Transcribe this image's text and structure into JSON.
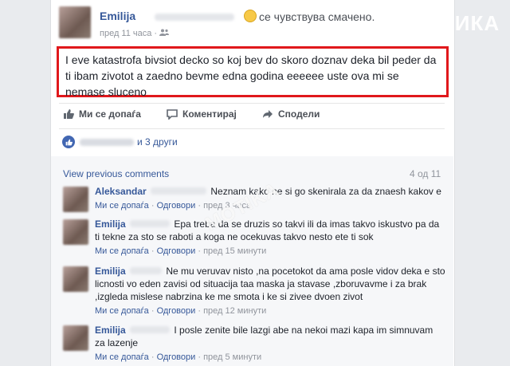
{
  "post": {
    "author": "Emilija",
    "feeling": "се чувствува смачено.",
    "time": "пред 11 часа",
    "dot": "·",
    "text": "I eve katastrofa bivsiot decko so koj bev do skoro doznav deka bil peder da ti ibam zivotot a zaedno bevme edna godina eeeeee uste ova mi se nemase sluceno"
  },
  "actions": {
    "like": "Ми се допаѓа",
    "comment": "Коментирај",
    "share": "Сподели"
  },
  "likes": {
    "suffix": "и 3 други"
  },
  "comments_header": {
    "view_previous": "View previous comments",
    "count": "4 од 11"
  },
  "comments": [
    {
      "name": "Aleksandar",
      "text": "Neznam kako ne si go skenirala za da znaesh kakov e",
      "like": "Ми се допаѓа",
      "reply": "Одговори",
      "time": "пред 3 часа"
    },
    {
      "name": "Emilija",
      "text": "Epa treba da se druzis so takvi ili da imas takvo iskustvo pa da ti tekne za sto se raboti a koga ne ocekuvas takvo nesto ete ti sok",
      "like": "Ми се допаѓа",
      "reply": "Одговори",
      "time": "пред 15 минути"
    },
    {
      "name": "Emilija",
      "text": "Ne mu veruvav nisto ,na pocetokot da ama posle vidov deka e sto licnosti vo eden zavisi od situacija taa maska ja stavase ,zboruvavme i za brak ,izgleda mislese nabrzina ke me smota i ke si zivee dvoen zivot",
      "like": "Ми се допаѓа",
      "reply": "Одговори",
      "time": "пред 12 минути"
    },
    {
      "name": "Emilija",
      "text": "I posle zenite bile lazgi abe na nekoi mazi kapa im simnuvam za lazenje",
      "like": "Ми се допаѓа",
      "reply": "Одговори",
      "time": "пред 5 минути"
    }
  ],
  "watermark": "МОТИКА",
  "watermark_diag": "MOTIKA"
}
